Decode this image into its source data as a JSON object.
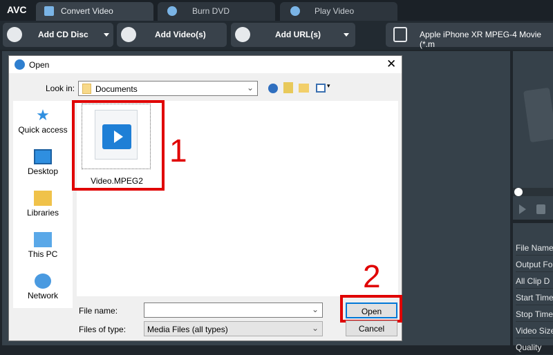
{
  "app": {
    "logo": "AVC",
    "tabs": [
      {
        "label": "Convert Video",
        "active": true
      },
      {
        "label": "Burn DVD"
      },
      {
        "label": "Play Video"
      }
    ]
  },
  "toolbar": {
    "add_cd": "Add CD Disc",
    "add_video": "Add Video(s)",
    "add_url": "Add URL(s)",
    "profile": "Apple iPhone XR MPEG-4 Movie (*.m"
  },
  "right_panel": {
    "props": [
      "File Name",
      "Output Fo",
      "All Clip D",
      "Start Time",
      "Stop Time",
      "Video Size",
      "Quality"
    ]
  },
  "dialog": {
    "title": "Open",
    "look_in_label": "Look in:",
    "look_in_value": "Documents",
    "places": [
      "Quick access",
      "Desktop",
      "Libraries",
      "This PC",
      "Network"
    ],
    "files": [
      {
        "name": "Video.MPEG2"
      }
    ],
    "file_name_label": "File name:",
    "file_name_value": "",
    "file_type_label": "Files of type:",
    "file_type_value": "Media Files (all types)",
    "open": "Open",
    "cancel": "Cancel"
  },
  "annotations": {
    "step1": "1",
    "step2": "2",
    "color": "#e00000"
  }
}
